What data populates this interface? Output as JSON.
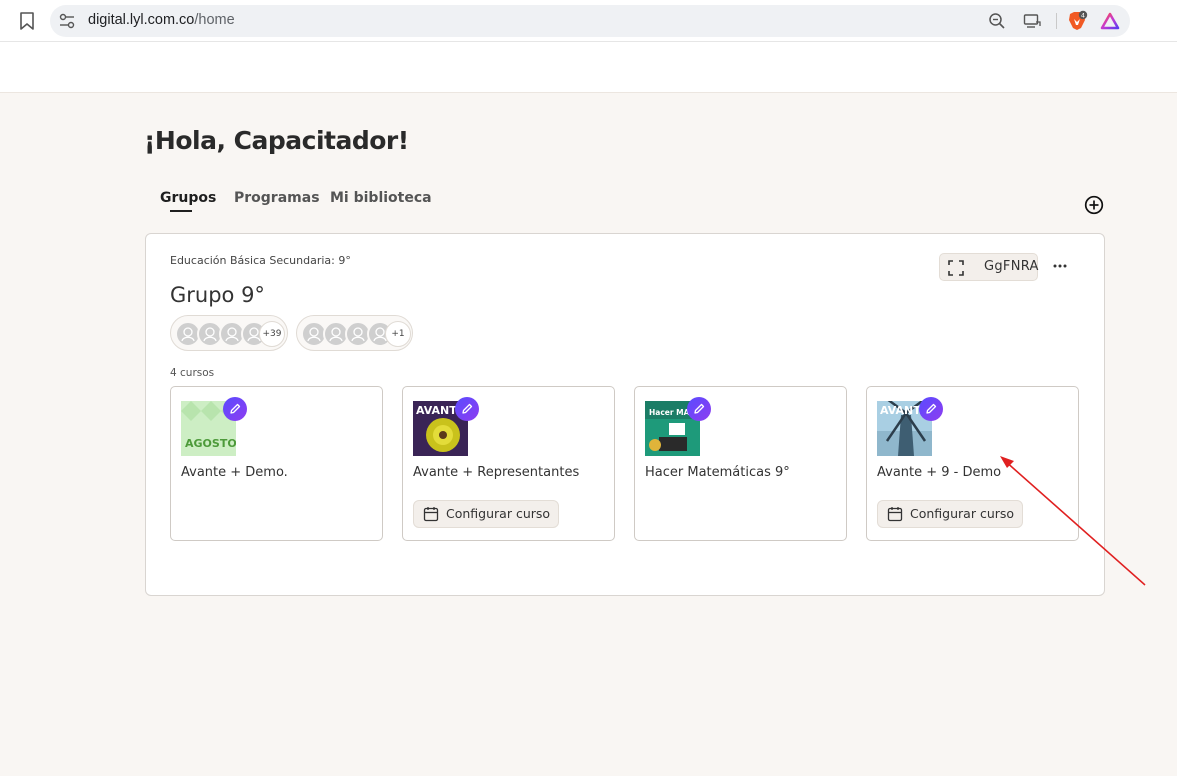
{
  "browser": {
    "url_host": "digital.lyl.com.co",
    "url_path": "/home",
    "brave_badge": "4"
  },
  "page": {
    "greeting": "¡Hola, Capacitador!",
    "tabs": [
      {
        "label": "Grupos",
        "active": true
      },
      {
        "label": "Programas",
        "active": false
      },
      {
        "label": "Mi biblioteca",
        "active": false
      }
    ]
  },
  "group": {
    "subtitle": "Educación Básica Secundaria: 9°",
    "title": "Grupo 9°",
    "code": "GgFNRA",
    "avatar_groups": [
      {
        "count": "+39"
      },
      {
        "count": "+1"
      }
    ],
    "courses_count": "4 cursos",
    "courses": [
      {
        "name": "Avante + Demo.",
        "thumb_text": "AGOSTO",
        "has_config": false
      },
      {
        "name": "Avante + Representantes",
        "thumb_text": "AVANTE",
        "has_config": true,
        "config_label": "Configurar curso"
      },
      {
        "name": "Hacer Matemáticas 9°",
        "thumb_text": "Hacer MATEMÁTICAS",
        "has_config": false
      },
      {
        "name": "Avante + 9 - Demo",
        "thumb_text": "AVANTE",
        "has_config": true,
        "config_label": "Configurar curso"
      }
    ]
  },
  "colors": {
    "accent_gradient_start": "#5a4bff",
    "accent_gradient_end": "#8e3df0",
    "page_background": "#f9f6f3",
    "annotation_arrow": "#e02020"
  }
}
